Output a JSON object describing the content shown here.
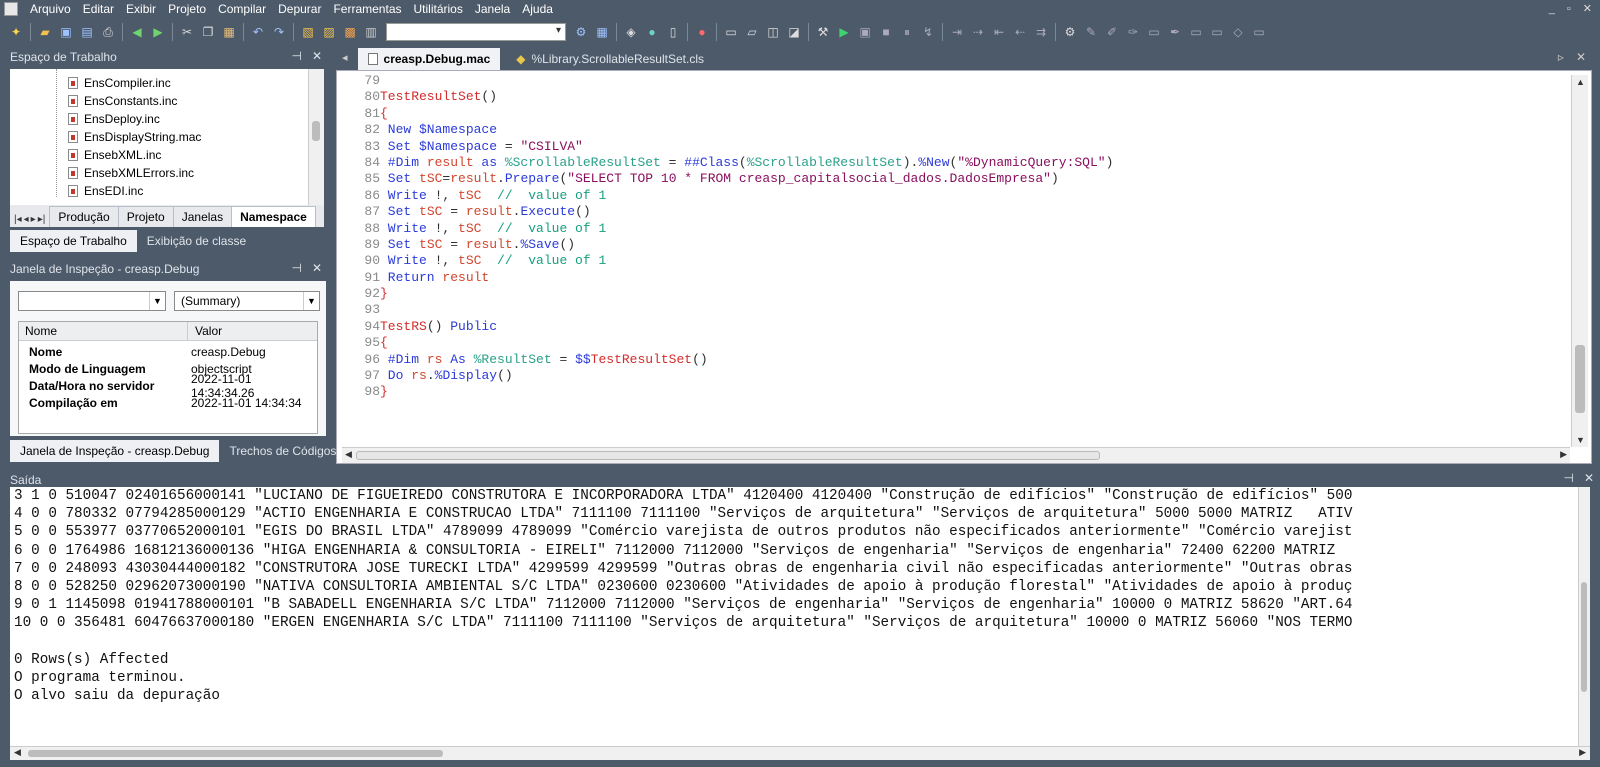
{
  "menu": [
    "Arquivo",
    "Editar",
    "Exibir",
    "Projeto",
    "Compilar",
    "Depurar",
    "Ferramentas",
    "Utilitários",
    "Janela",
    "Ajuda"
  ],
  "window_controls": [
    "_",
    "▫",
    "✕"
  ],
  "workspace": {
    "title": "Espaço de Trabalho",
    "items": [
      "EnsCompiler.inc",
      "EnsConstants.inc",
      "EnsDeploy.inc",
      "EnsDisplayString.mac",
      "EnsebXML.inc",
      "EnsebXMLErrors.inc",
      "EnsEDI.inc"
    ],
    "tabs": [
      "Produção",
      "Projeto",
      "Janelas",
      "Namespace"
    ],
    "bottom_tabs": [
      "Espaço de Trabalho",
      "Exibição de classe"
    ]
  },
  "inspector": {
    "title": "Janela de Inspeção - creasp.Debug",
    "combo1": "",
    "combo2": "(Summary)",
    "col_name": "Nome",
    "col_value": "Valor",
    "rows": [
      {
        "name": "Nome",
        "value": "creasp.Debug"
      },
      {
        "name": "Modo de Linguagem",
        "value": "objectscript"
      },
      {
        "name": "Data/Hora no servidor",
        "value": "2022-11-01 14:34:34.26"
      },
      {
        "name": "Compilação em",
        "value": "2022-11-01 14:34:34"
      }
    ],
    "bottom_tabs": [
      "Janela de Inspeção - creasp.Debug",
      "Trechos de Códigos"
    ]
  },
  "editor": {
    "tabs": [
      "creasp.Debug.mac",
      "%Library.ScrollableResultSet.cls"
    ],
    "lines": [
      {
        "n": "79",
        "parts": []
      },
      {
        "n": "80",
        "parts": [
          [
            "r",
            "TestResultSet"
          ],
          [
            "p",
            "()"
          ]
        ]
      },
      {
        "n": "81",
        "parts": [
          [
            "r",
            "{"
          ]
        ]
      },
      {
        "n": "82",
        "parts": [
          [
            "k",
            " New $Namespace"
          ]
        ]
      },
      {
        "n": "83",
        "parts": [
          [
            "k",
            " Set $Namespace "
          ],
          [
            "p",
            "= "
          ],
          [
            "s",
            "\"CSILVA\""
          ]
        ]
      },
      {
        "n": "84",
        "parts": [
          [
            "k",
            " #Dim "
          ],
          [
            "t",
            "result "
          ],
          [
            "k",
            "as "
          ],
          [
            "g",
            "%ScrollableResultSet "
          ],
          [
            "p",
            "= "
          ],
          [
            "k",
            "##Class"
          ],
          [
            "p",
            "("
          ],
          [
            "g",
            "%ScrollableResultSet"
          ],
          [
            "p",
            ")."
          ],
          [
            "k",
            "%New"
          ],
          [
            "p",
            "("
          ],
          [
            "s",
            "\"%DynamicQuery:SQL\""
          ],
          [
            "p",
            ")"
          ]
        ]
      },
      {
        "n": "85",
        "parts": [
          [
            "k",
            " Set "
          ],
          [
            "t",
            "tSC"
          ],
          [
            "p",
            "="
          ],
          [
            "t",
            "result"
          ],
          [
            "p",
            "."
          ],
          [
            "k",
            "Prepare"
          ],
          [
            "p",
            "("
          ],
          [
            "s",
            "\"SELECT TOP 10 * FROM creasp_capitalsocial_dados.DadosEmpresa\""
          ],
          [
            "p",
            ")"
          ]
        ]
      },
      {
        "n": "86",
        "parts": [
          [
            "k",
            " Write "
          ],
          [
            "p",
            "!, "
          ],
          [
            "t",
            "tSC  "
          ],
          [
            "c",
            "//  value of 1"
          ]
        ]
      },
      {
        "n": "87",
        "parts": [
          [
            "k",
            " Set "
          ],
          [
            "t",
            "tSC "
          ],
          [
            "p",
            "= "
          ],
          [
            "t",
            "result"
          ],
          [
            "p",
            "."
          ],
          [
            "k",
            "Execute"
          ],
          [
            "p",
            "()"
          ]
        ]
      },
      {
        "n": "88",
        "parts": [
          [
            "k",
            " Write "
          ],
          [
            "p",
            "!, "
          ],
          [
            "t",
            "tSC  "
          ],
          [
            "c",
            "//  value of 1"
          ]
        ]
      },
      {
        "n": "89",
        "parts": [
          [
            "k",
            " Set "
          ],
          [
            "t",
            "tSC "
          ],
          [
            "p",
            "= "
          ],
          [
            "t",
            "result"
          ],
          [
            "p",
            "."
          ],
          [
            "k",
            "%Save"
          ],
          [
            "p",
            "()"
          ]
        ]
      },
      {
        "n": "90",
        "parts": [
          [
            "k",
            " Write "
          ],
          [
            "p",
            "!, "
          ],
          [
            "t",
            "tSC  "
          ],
          [
            "c",
            "//  value of 1"
          ]
        ]
      },
      {
        "n": "91",
        "parts": [
          [
            "k",
            " Return "
          ],
          [
            "t",
            "result"
          ]
        ]
      },
      {
        "n": "92",
        "parts": [
          [
            "r",
            "}"
          ]
        ]
      },
      {
        "n": "93",
        "parts": []
      },
      {
        "n": "94",
        "parts": [
          [
            "r",
            "TestRS"
          ],
          [
            "p",
            "() "
          ],
          [
            "k",
            "Public"
          ]
        ]
      },
      {
        "n": "95",
        "parts": [
          [
            "r",
            "{"
          ]
        ]
      },
      {
        "n": "96",
        "parts": [
          [
            "k",
            " #Dim "
          ],
          [
            "t",
            "rs "
          ],
          [
            "k",
            "As "
          ],
          [
            "g",
            "%ResultSet "
          ],
          [
            "p",
            "= "
          ],
          [
            "k",
            "$$"
          ],
          [
            "r",
            "TestResultSet"
          ],
          [
            "p",
            "()"
          ]
        ]
      },
      {
        "n": "97",
        "parts": [
          [
            "k",
            " Do "
          ],
          [
            "t",
            "rs"
          ],
          [
            "p",
            "."
          ],
          [
            "k",
            "%Display"
          ],
          [
            "p",
            "()"
          ]
        ]
      },
      {
        "n": "98",
        "parts": [
          [
            "r",
            "}"
          ]
        ]
      }
    ]
  },
  "output": {
    "title": "Saída",
    "lines": [
      "3 1 0 510047 02401656000141 \"LUCIANO DE FIGUEIREDO CONSTRUTORA E INCORPORADORA LTDA\" 4120400 4120400 \"Construção de edifícios\" \"Construção de edifícios\" 500",
      "4 0 0 780332 07794285000129 \"ACTIO ENGENHARIA E CONSTRUCAO LTDA\" 7111100 7111100 \"Serviços de arquitetura\" \"Serviços de arquitetura\" 5000 5000 MATRIZ   ATIV",
      "5 0 0 553977 03770652000101 \"EGIS DO BRASIL LTDA\" 4789099 4789099 \"Comércio varejista de outros produtos não especificados anteriormente\" \"Comércio varejist",
      "6 0 0 1764986 16812136000136 \"HIGA ENGENHARIA & CONSULTORIA - EIRELI\" 7112000 7112000 \"Serviços de engenharia\" \"Serviços de engenharia\" 72400 62200 MATRIZ",
      "7 0 0 248093 43030444000182 \"CONSTRUTORA JOSE TURECKI LTDA\" 4299599 4299599 \"Outras obras de engenharia civil não especificadas anteriormente\" \"Outras obras",
      "8 0 0 528250 02962073000190 \"NATIVA CONSULTORIA AMBIENTAL S/C LTDA\" 0230600 0230600 \"Atividades de apoio à produção florestal\" \"Atividades de apoio à produç",
      "9 0 1 1145098 01941788000101 \"B SABADELL ENGENHARIA S/C LTDA\" 7112000 7112000 \"Serviços de engenharia\" \"Serviços de engenharia\" 10000 0 MATRIZ 58620 \"ART.64",
      "10 0 0 356481 60476637000180 \"ERGEN ENGENHARIA S/C LTDA\" 7111100 7111100 \"Serviços de arquitetura\" \"Serviços de arquitetura\" 10000 0 MATRIZ 56060 \"NOS TERMO",
      "",
      "0 Rows(s) Affected",
      "O programa terminou.",
      "O alvo saiu da depuração"
    ]
  }
}
